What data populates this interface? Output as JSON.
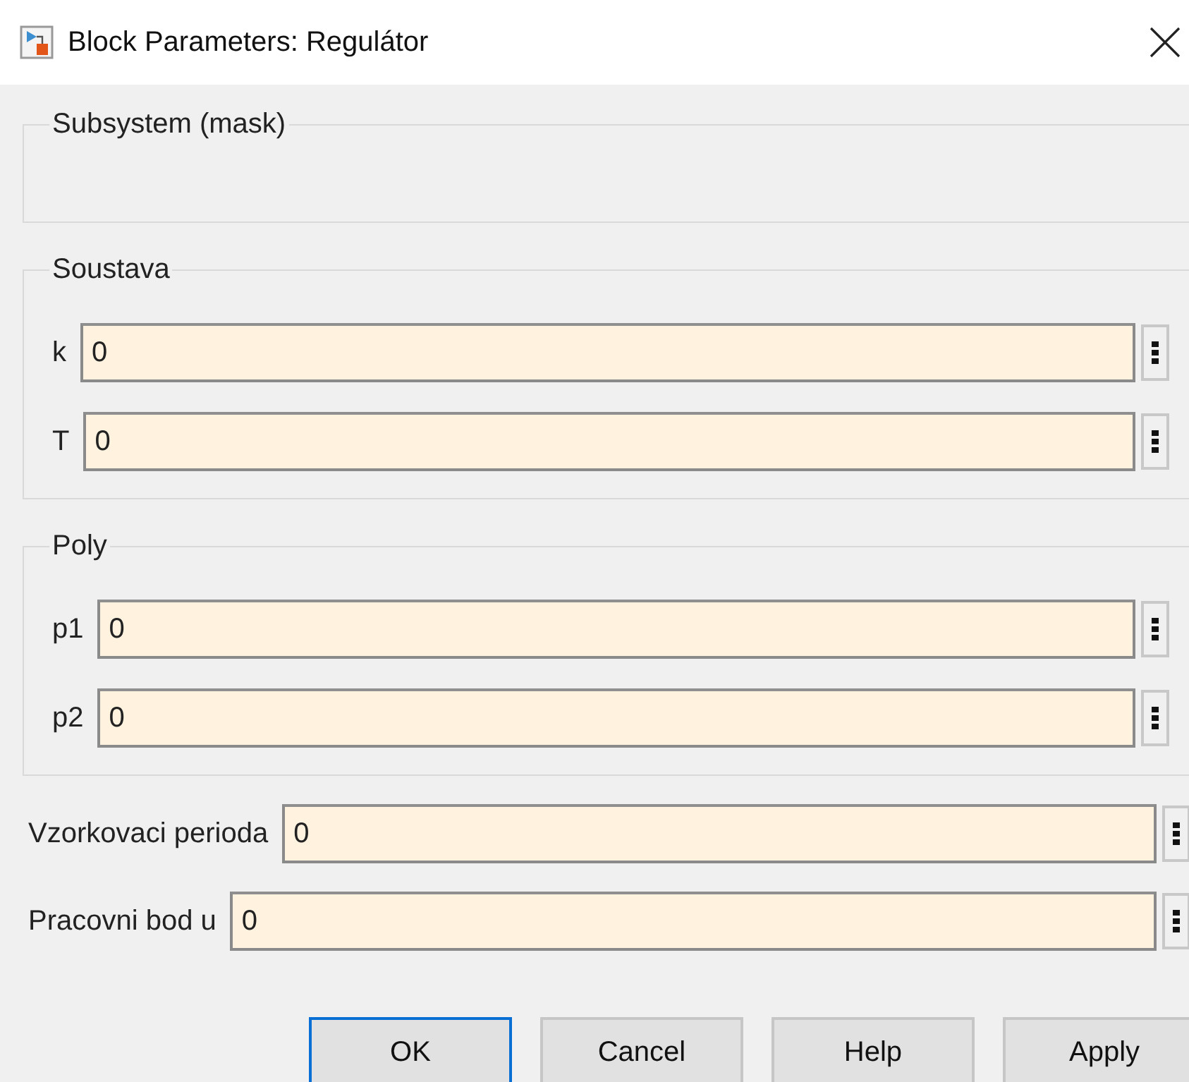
{
  "window": {
    "title": "Block Parameters: Regulátor"
  },
  "groups": [
    {
      "title": "Subsystem (mask)"
    },
    {
      "title": "Soustava",
      "params": [
        {
          "label": "k",
          "value": "0"
        },
        {
          "label": "T",
          "value": "0"
        }
      ]
    },
    {
      "title": "Poly",
      "params": [
        {
          "label": "p1",
          "value": "0"
        },
        {
          "label": "p2",
          "value": "0"
        }
      ]
    }
  ],
  "params": [
    {
      "label": "Vzorkovaci perioda",
      "value": "0"
    },
    {
      "label": "Pracovni bod u",
      "value": "0"
    }
  ],
  "buttons": [
    {
      "label": "OK",
      "focused": true
    },
    {
      "label": "Cancel",
      "focused": false
    },
    {
      "label": "Help",
      "focused": false
    },
    {
      "label": "Apply",
      "focused": false
    }
  ]
}
